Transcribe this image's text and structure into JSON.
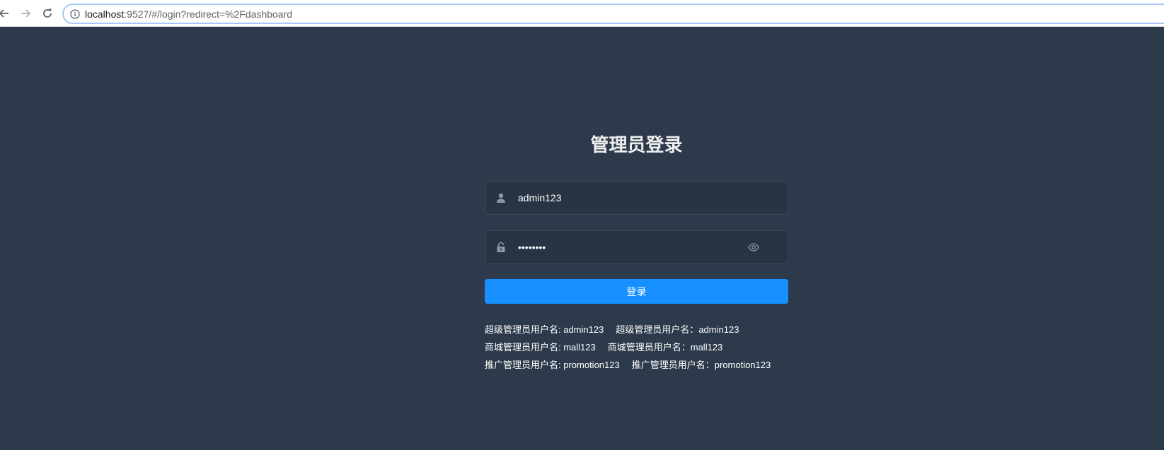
{
  "browser": {
    "url_host": "localhost",
    "url_rest": ":9527/#/login?redirect=%2Fdashboard"
  },
  "login": {
    "title": "管理员登录",
    "username_value": "admin123",
    "password_value": "••••••••",
    "submit_label": "登录"
  },
  "tips": [
    {
      "left": "超级管理员用户名: admin123",
      "right": "超级管理员用户名：admin123"
    },
    {
      "left": "商城管理员用户名: mall123",
      "right": "商城管理员用户名：mall123"
    },
    {
      "left": "推广管理员用户名: promotion123",
      "right": "推广管理员用户名：promotion123"
    }
  ],
  "icons": {
    "back": "arrow-left-icon",
    "forward": "arrow-right-icon",
    "reload": "reload-icon",
    "info": "info-icon",
    "user": "user-icon",
    "lock": "lock-icon",
    "eye": "eye-icon"
  },
  "colors": {
    "background": "#2d3a4b",
    "primary": "#1890ff",
    "title": "#eeeeee"
  }
}
